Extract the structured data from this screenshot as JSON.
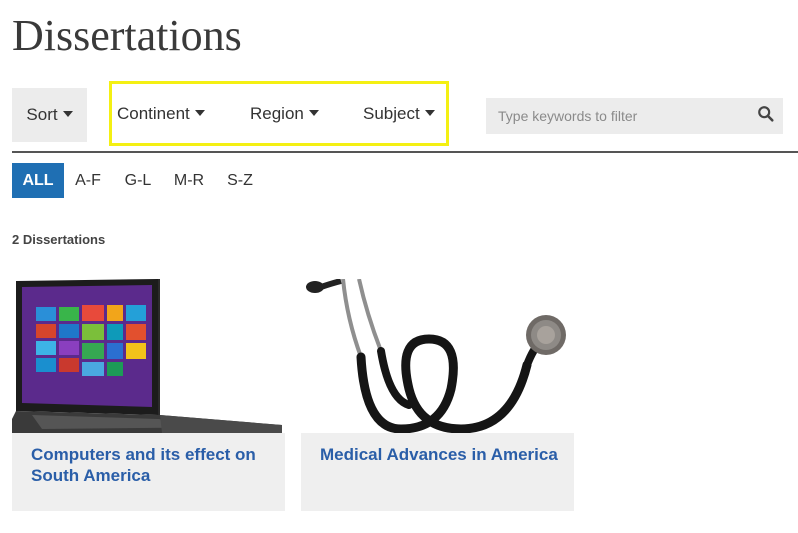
{
  "page": {
    "title": "Dissertations"
  },
  "toolbar": {
    "sort_label": "Sort",
    "filters": [
      {
        "label": "Continent"
      },
      {
        "label": "Region"
      },
      {
        "label": "Subject"
      }
    ],
    "highlight_color": "#f4f013",
    "search": {
      "placeholder": "Type keywords to filter",
      "value": ""
    }
  },
  "alphabet_tabs": [
    {
      "label": "ALL",
      "active": true
    },
    {
      "label": "A-F",
      "active": false
    },
    {
      "label": "G-L",
      "active": false
    },
    {
      "label": "M-R",
      "active": false
    },
    {
      "label": "S-Z",
      "active": false
    }
  ],
  "results": {
    "count_text": "2 Dissertations",
    "items": [
      {
        "title": "Computers and its effect on South America",
        "image_icon": "laptop-image"
      },
      {
        "title": "Medical Advances in America",
        "image_icon": "stethoscope-image"
      }
    ]
  },
  "colors": {
    "accent": "#1f6fb3",
    "link": "#2a5ea8",
    "panel": "#ececec"
  }
}
